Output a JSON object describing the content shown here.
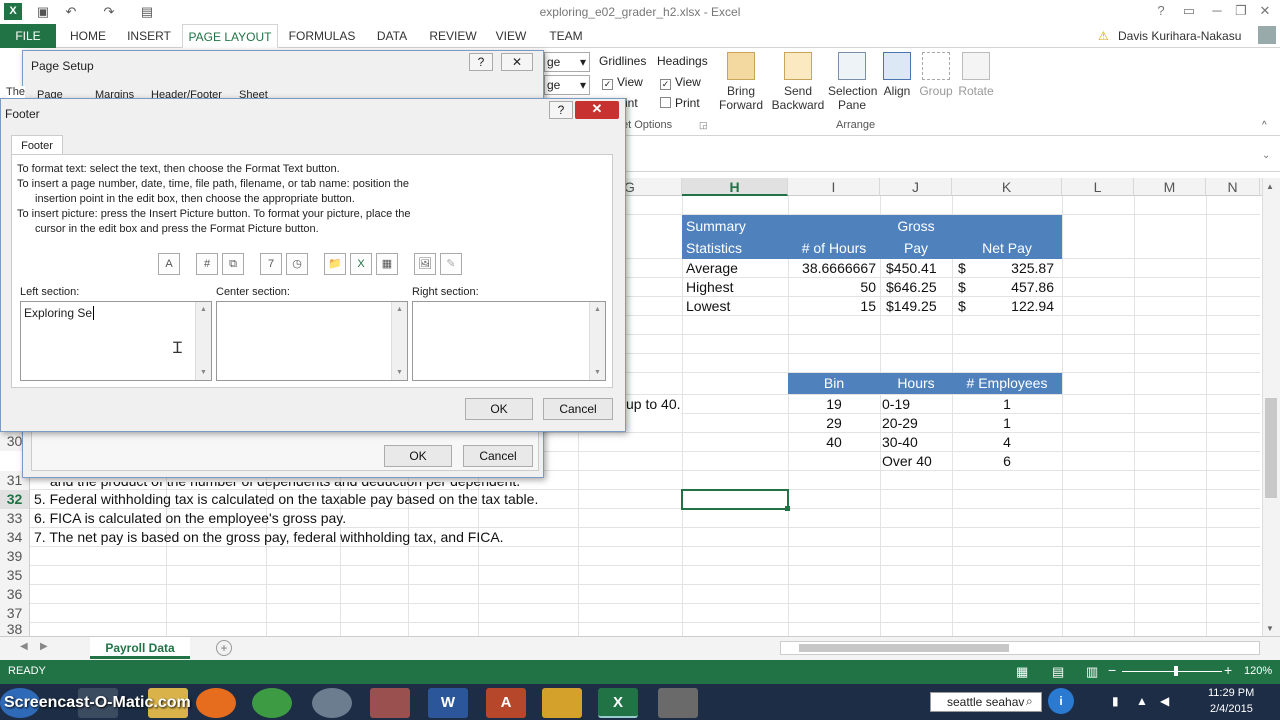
{
  "window": {
    "title": "exploring_e02_grader_h2.xlsx - Excel"
  },
  "ribbon": {
    "tabs": [
      "FILE",
      "HOME",
      "INSERT",
      "PAGE LAYOUT",
      "FORMULAS",
      "DATA",
      "REVIEW",
      "VIEW",
      "TEAM"
    ],
    "active_tab": "PAGE LAYOUT",
    "user": "Davis Kurihara-Nakasu",
    "size_frag1": "ge",
    "size_frag2": "ge",
    "sheet_options": {
      "gridlines": "Gridlines",
      "headings": "Headings",
      "view": "View",
      "print": "Print",
      "print_frag": "rint",
      "group_label": "et Options"
    },
    "arrange": {
      "bring_forward": "Bring Forward",
      "send_backward": "Send Backward",
      "selection_pane": "Selection Pane",
      "align": "Align",
      "group": "Group",
      "rotate": "Rotate",
      "label": "Arrange"
    }
  },
  "grid": {
    "columns": [
      "G",
      "H",
      "I",
      "J",
      "K",
      "L",
      "M",
      "N"
    ],
    "selected_column": "H",
    "rows": [
      "30",
      "31",
      "32",
      "33",
      "34",
      "35",
      "36",
      "37",
      "38",
      "39"
    ],
    "selected_row": "32",
    "summary": {
      "h_header1": "Summary",
      "h_header2": "Statistics",
      "i_header": "# of Hours",
      "j_header1": "Gross",
      "j_header2": "Pay",
      "k_header": "Net Pay",
      "rows": [
        {
          "label": "Average",
          "hours": "38.6666667",
          "gross": "$450.41",
          "dollar": "$",
          "net": "325.87"
        },
        {
          "label": "Highest",
          "hours": "50",
          "gross": "$646.25",
          "dollar": "$",
          "net": "457.86"
        },
        {
          "label": "Lowest",
          "hours": "15",
          "gross": "$149.25",
          "dollar": "$",
          "net": "122.94"
        }
      ]
    },
    "bins": {
      "headers": [
        "Bin",
        "Hours",
        "# Employees"
      ],
      "rows": [
        {
          "bin": "19",
          "hours": "0-19",
          "emp": "1"
        },
        {
          "bin": "29",
          "hours": "20-29",
          "emp": "1"
        },
        {
          "bin": "40",
          "hours": "30-40",
          "emp": "4"
        },
        {
          "bin": "",
          "hours": "Over 40",
          "emp": "6"
        }
      ]
    },
    "notes": {
      "up_to_40": "up to 40.",
      "r31": "and the product of the number of dependents and deduction per dependent.",
      "r32": "5. Federal withholding tax is calculated on the taxable pay based on the tax table.",
      "r33": "6. FICA is calculated on the employee's gross pay.",
      "r34": "7. The net pay is based on the gross pay, federal withholding tax, and FICA."
    },
    "frag_the": "The"
  },
  "sheet": {
    "tab": "Payroll Data"
  },
  "status": {
    "ready": "READY",
    "zoom": "120%"
  },
  "taskbar": {
    "watermark": "Screencast-O-Matic.com",
    "search": "seattle seahav",
    "time": "11:29 PM",
    "date": "2/4/2015"
  },
  "page_setup": {
    "title": "Page Setup",
    "tabs": [
      "Page",
      "Margins",
      "Header/Footer",
      "Sheet"
    ],
    "ok": "OK",
    "cancel": "Cancel",
    "help": "?",
    "close": "✕"
  },
  "footer_dialog": {
    "title": "Footer",
    "tab": "Footer",
    "instructions": [
      "To format text:  select the text, then choose the Format Text button.",
      "To insert a page number, date, time, file path, filename, or tab name:  position the",
      "insertion point in the edit box, then choose the appropriate button.",
      "To insert picture: press the Insert Picture button.  To format your picture, place the",
      "cursor in the edit box and press the Format Picture button."
    ],
    "left_label": "Left section:",
    "center_label": "Center section:",
    "right_label": "Right section:",
    "left_value": "Exploring Se",
    "center_value": "",
    "right_value": "",
    "ok": "OK",
    "cancel": "Cancel",
    "help": "?",
    "close": "✕",
    "toolbar": [
      "A",
      "#",
      "⧉",
      "7",
      "◷",
      "📁",
      "X",
      "▦",
      "🖼",
      "✎"
    ]
  },
  "colors": {
    "excel_green": "#217346",
    "table_blue": "#4f81bd",
    "taskbar": "#1c2d45"
  }
}
